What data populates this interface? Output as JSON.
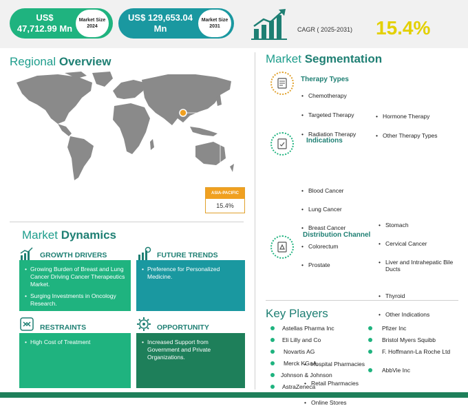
{
  "header": {
    "market_size_2024_value": "US$ 47,712.99 Mn",
    "market_size_2024_label": "Market Size 2024",
    "market_size_2031_value": "US$ 129,653.04 Mn",
    "market_size_2031_label": "Market Size 2031",
    "cagr_label": "CAGR ( 2025-2031)",
    "cagr_value": "15.4%"
  },
  "regional": {
    "title_light": "Regional ",
    "title_bold": "Overview",
    "region_name": "ASIA-PACIFIC",
    "region_value": "15.4%"
  },
  "dynamics": {
    "title_light": "Market ",
    "title_bold": "Dynamics",
    "growth_drivers": {
      "title": "GROWTH DRIVERS",
      "items": [
        "Growing Burden of Breast and Lung Cancer Driving Cancer Therapeutics Market.",
        "Surging Investments in Oncology Research."
      ]
    },
    "future_trends": {
      "title": "FUTURE TRENDS",
      "items": [
        "Preference for Personalized Medicine."
      ]
    },
    "restraints": {
      "title": "RESTRAINTS",
      "items": [
        "High Cost of Treatment"
      ]
    },
    "opportunity": {
      "title": "OPPORTUNITY",
      "items": [
        "Increased Support from Government and Private Organizations."
      ]
    }
  },
  "segmentation": {
    "title_light": "Market ",
    "title_bold": "Segmentation",
    "therapy_types": {
      "title": "Therapy Types",
      "col1": [
        "Chemotherapy",
        "Targeted Therapy",
        "Radiation Therapy"
      ],
      "col2": [
        "Hormone Therapy",
        "Other Therapy Types"
      ]
    },
    "indications": {
      "title": "Indications",
      "col1": [
        "Blood Cancer",
        "Lung Cancer",
        "Breast Cancer",
        "Colorectum",
        "Prostate"
      ],
      "col2": [
        "Stomach",
        "Cervical Cancer",
        "Liver and Intrahepatic Bile Ducts",
        "Thyroid",
        "Other Indications"
      ]
    },
    "distribution": {
      "title": "Distribution Channel",
      "items": [
        "Hospital Pharmacies",
        "Retail Pharmacies",
        "Online Stores"
      ]
    }
  },
  "key_players": {
    "title": "Key Players",
    "col1": [
      "Astellas Pharma Inc",
      "Eli Lilly and Co",
      "Novartis AG",
      "Merck KGaA.",
      "Johnson & Johnson",
      "AstraZeneca"
    ],
    "col2": [
      "Pfizer Inc",
      "Bristol Myers Squibb",
      "F. Hoffmann-La Roche Ltd",
      "AbbVie Inc"
    ]
  },
  "colors": {
    "green": "#1fb37f",
    "teal": "#1a98a0",
    "dark_teal": "#1e7f73",
    "accent_yellow": "#e3d000",
    "asia_orange": "#f0a020"
  }
}
